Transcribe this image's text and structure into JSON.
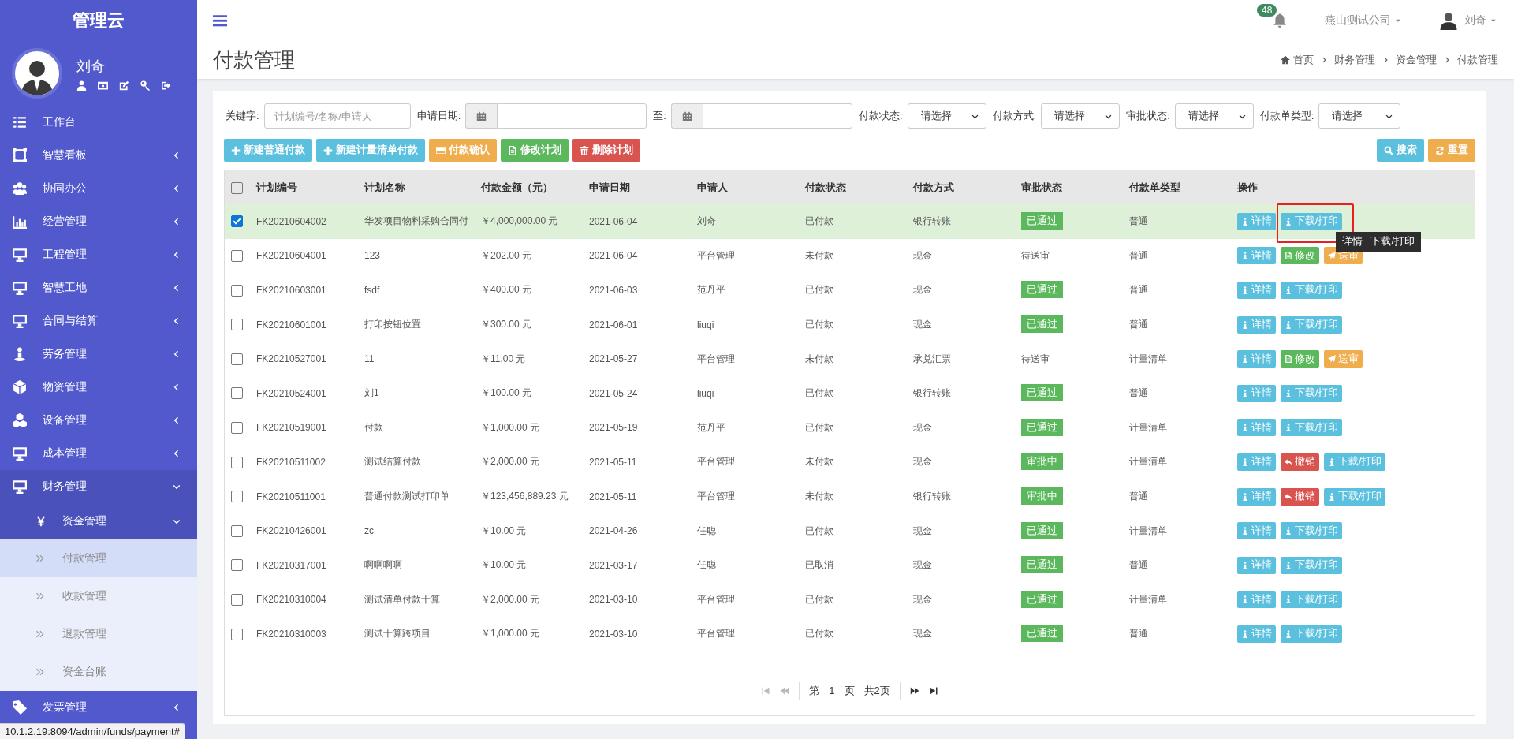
{
  "app": {
    "title": "管理云"
  },
  "user": {
    "name": "刘奇"
  },
  "sidebar": {
    "items": [
      {
        "label": "工作台",
        "kind": "link"
      },
      {
        "label": "智慧看板",
        "kind": "menu",
        "expanded": false
      },
      {
        "label": "协同办公",
        "kind": "menu",
        "expanded": false
      },
      {
        "label": "经营管理",
        "kind": "menu",
        "expanded": false
      },
      {
        "label": "工程管理",
        "kind": "menu",
        "expanded": false
      },
      {
        "label": "智慧工地",
        "kind": "menu",
        "expanded": false
      },
      {
        "label": "合同与结算",
        "kind": "menu",
        "expanded": false
      },
      {
        "label": "劳务管理",
        "kind": "menu",
        "expanded": false
      },
      {
        "label": "物资管理",
        "kind": "menu",
        "expanded": false
      },
      {
        "label": "设备管理",
        "kind": "menu",
        "expanded": false
      },
      {
        "label": "成本管理",
        "kind": "menu",
        "expanded": false
      },
      {
        "label": "财务管理",
        "kind": "menu",
        "expanded": true,
        "children": [
          {
            "label": "资金管理",
            "expanded": true,
            "children": [
              {
                "label": "付款管理",
                "selected": true
              },
              {
                "label": "收款管理",
                "selected": false
              },
              {
                "label": "退款管理",
                "selected": false
              },
              {
                "label": "资金台账",
                "selected": false
              }
            ]
          }
        ]
      },
      {
        "label": "发票管理",
        "kind": "menu",
        "expanded": false
      }
    ]
  },
  "topbar": {
    "notifications": "48",
    "company": "燕山测试公司",
    "user": "刘奇"
  },
  "page": {
    "title": "付款管理",
    "breadcrumb": [
      "首页",
      "财务管理",
      "资金管理",
      "付款管理"
    ]
  },
  "filters": {
    "keyword": {
      "label": "关键字:",
      "placeholder": "计划编号/名称/申请人"
    },
    "date": {
      "label": "申请日期:",
      "to": "至:"
    },
    "selects": [
      {
        "label": "付款状态:",
        "value": "请选择"
      },
      {
        "label": "付款方式:",
        "value": "请选择"
      },
      {
        "label": "审批状态:",
        "value": "请选择"
      },
      {
        "label": "付款单类型:",
        "value": "请选择"
      }
    ]
  },
  "toolbar": {
    "buttons": [
      {
        "label": "新建普通付款",
        "kind": "add"
      },
      {
        "label": "新建计量清单付款",
        "kind": "add"
      },
      {
        "label": "付款确认",
        "kind": "confirm"
      },
      {
        "label": "修改计划",
        "kind": "edit"
      },
      {
        "label": "删除计划",
        "kind": "delete"
      }
    ],
    "right_buttons": [
      {
        "label": "搜索",
        "kind": "search"
      },
      {
        "label": "重置",
        "kind": "reset"
      }
    ]
  },
  "table": {
    "all_checked": false,
    "columns": [
      "计划编号",
      "计划名称",
      "付款金额（元）",
      "申请日期",
      "申请人",
      "付款状态",
      "付款方式",
      "审批状态",
      "付款单类型",
      "操作"
    ],
    "rows": [
      {
        "checked": true,
        "cells": [
          "FK20210604002",
          "华发项目物料采购合同付",
          "￥4,000,000.00 元",
          "2021-06-04",
          "刘奇",
          "已付款",
          "银行转账"
        ],
        "approval": {
          "text": "已通过",
          "kind": "badge"
        },
        "type": "普通",
        "actions": [
          {
            "label": "详情",
            "kind": "info"
          },
          {
            "label": "下载/打印",
            "kind": "download",
            "highlighted": true,
            "tooltip": "详情   下载/打印"
          }
        ]
      },
      {
        "checked": false,
        "cells": [
          "FK20210604001",
          "123",
          "￥202.00 元",
          "2021-06-04",
          "平台管理",
          "未付款",
          "现金"
        ],
        "approval": {
          "text": "待送审",
          "kind": "text"
        },
        "type": "普通",
        "actions": [
          {
            "label": "详情",
            "kind": "info"
          },
          {
            "label": "修改",
            "kind": "edit"
          },
          {
            "label": "送审",
            "kind": "send"
          }
        ]
      },
      {
        "checked": false,
        "cells": [
          "FK20210603001",
          "fsdf",
          "￥400.00 元",
          "2021-06-03",
          "范丹平",
          "已付款",
          "现金"
        ],
        "approval": {
          "text": "已通过",
          "kind": "badge"
        },
        "type": "普通",
        "actions": [
          {
            "label": "详情",
            "kind": "info"
          },
          {
            "label": "下载/打印",
            "kind": "download"
          }
        ]
      },
      {
        "checked": false,
        "cells": [
          "FK20210601001",
          "打印按钮位置",
          "￥300.00 元",
          "2021-06-01",
          "liuqi",
          "已付款",
          "现金"
        ],
        "approval": {
          "text": "已通过",
          "kind": "badge"
        },
        "type": "普通",
        "actions": [
          {
            "label": "详情",
            "kind": "info"
          },
          {
            "label": "下载/打印",
            "kind": "download"
          }
        ]
      },
      {
        "checked": false,
        "cells": [
          "FK20210527001",
          "11",
          "￥11.00 元",
          "2021-05-27",
          "平台管理",
          "未付款",
          "承兑汇票"
        ],
        "approval": {
          "text": "待送审",
          "kind": "text"
        },
        "type": "计量清单",
        "actions": [
          {
            "label": "详情",
            "kind": "info"
          },
          {
            "label": "修改",
            "kind": "edit"
          },
          {
            "label": "送审",
            "kind": "send"
          }
        ]
      },
      {
        "checked": false,
        "cells": [
          "FK20210524001",
          "刘1",
          "￥100.00 元",
          "2021-05-24",
          "liuqi",
          "已付款",
          "银行转账"
        ],
        "approval": {
          "text": "已通过",
          "kind": "badge"
        },
        "type": "普通",
        "actions": [
          {
            "label": "详情",
            "kind": "info"
          },
          {
            "label": "下载/打印",
            "kind": "download"
          }
        ]
      },
      {
        "checked": false,
        "cells": [
          "FK20210519001",
          "付款",
          "￥1,000.00 元",
          "2021-05-19",
          "范丹平",
          "已付款",
          "现金"
        ],
        "approval": {
          "text": "已通过",
          "kind": "badge"
        },
        "type": "计量清单",
        "actions": [
          {
            "label": "详情",
            "kind": "info"
          },
          {
            "label": "下载/打印",
            "kind": "download"
          }
        ]
      },
      {
        "checked": false,
        "cells": [
          "FK20210511002",
          "测试结算付款",
          "￥2,000.00 元",
          "2021-05-11",
          "平台管理",
          "未付款",
          "现金"
        ],
        "approval": {
          "text": "审批中",
          "kind": "badge"
        },
        "type": "计量清单",
        "actions": [
          {
            "label": "详情",
            "kind": "info"
          },
          {
            "label": "撤销",
            "kind": "revoke"
          },
          {
            "label": "下载/打印",
            "kind": "download"
          }
        ]
      },
      {
        "checked": false,
        "cells": [
          "FK20210511001",
          "普通付款测试打印单",
          "￥123,456,889.23 元",
          "2021-05-11",
          "平台管理",
          "未付款",
          "银行转账"
        ],
        "approval": {
          "text": "审批中",
          "kind": "badge"
        },
        "type": "普通",
        "actions": [
          {
            "label": "详情",
            "kind": "info"
          },
          {
            "label": "撤销",
            "kind": "revoke"
          },
          {
            "label": "下载/打印",
            "kind": "download"
          }
        ]
      },
      {
        "checked": false,
        "cells": [
          "FK20210426001",
          "zc",
          "￥10.00 元",
          "2021-04-26",
          "任聪",
          "已付款",
          "现金"
        ],
        "approval": {
          "text": "已通过",
          "kind": "badge"
        },
        "type": "计量清单",
        "actions": [
          {
            "label": "详情",
            "kind": "info"
          },
          {
            "label": "下载/打印",
            "kind": "download"
          }
        ]
      },
      {
        "checked": false,
        "cells": [
          "FK20210317001",
          "啊啊啊啊",
          "￥10.00 元",
          "2021-03-17",
          "任聪",
          "已取消",
          "现金"
        ],
        "approval": {
          "text": "已通过",
          "kind": "badge"
        },
        "type": "普通",
        "actions": [
          {
            "label": "详情",
            "kind": "info"
          },
          {
            "label": "下载/打印",
            "kind": "download"
          }
        ]
      },
      {
        "checked": false,
        "cells": [
          "FK20210310004",
          "测试清单付款十算",
          "￥2,000.00 元",
          "2021-03-10",
          "平台管理",
          "已付款",
          "现金"
        ],
        "approval": {
          "text": "已通过",
          "kind": "badge"
        },
        "type": "计量清单",
        "actions": [
          {
            "label": "详情",
            "kind": "info"
          },
          {
            "label": "下载/打印",
            "kind": "download"
          }
        ]
      },
      {
        "checked": false,
        "cells": [
          "FK20210310003",
          "测试十算跨项目",
          "￥1,000.00 元",
          "2021-03-10",
          "平台管理",
          "已付款",
          "现金"
        ],
        "approval": {
          "text": "已通过",
          "kind": "badge"
        },
        "type": "普通",
        "actions": [
          {
            "label": "详情",
            "kind": "info"
          },
          {
            "label": "下载/打印",
            "kind": "download"
          }
        ]
      }
    ]
  },
  "pager": {
    "prefix": "第",
    "page": "1",
    "suffix": "页",
    "total": "共2页"
  },
  "status_bar": {
    "url": "10.1.2.19:8094/admin/funds/payment#"
  }
}
